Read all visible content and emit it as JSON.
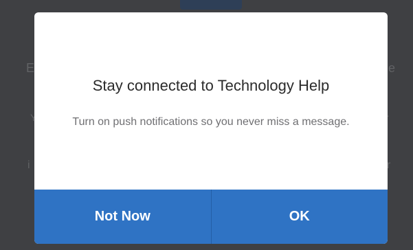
{
  "background": {
    "left_glyph_1": "E",
    "right_glyph_1": "e",
    "left_glyph_2": "Y",
    "right_glyph_2": "r",
    "left_glyph_3": "i",
    "right_glyph_3": "r"
  },
  "dialog": {
    "title": "Stay connected to Technology Help",
    "message": "Turn on push notifications so you never miss a message.",
    "not_now_label": "Not Now",
    "ok_label": "OK"
  },
  "colors": {
    "overlay": "#3f4043",
    "dialog_background": "#ffffff",
    "button_accent": "#2f73c4",
    "button_text": "#ffffff"
  }
}
